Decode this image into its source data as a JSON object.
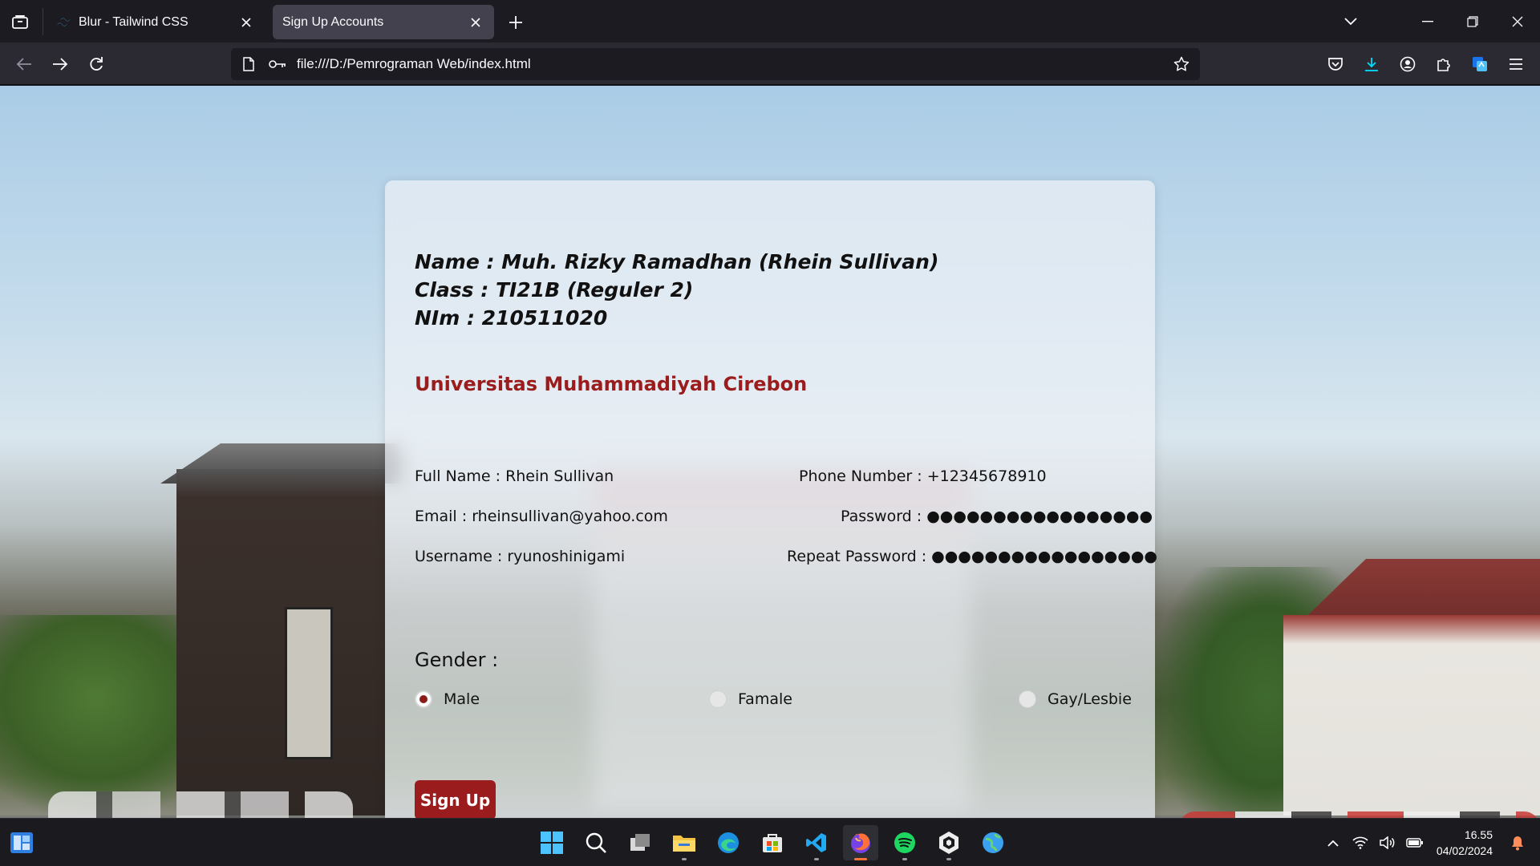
{
  "browser": {
    "tabs": [
      {
        "title": "Blur - Tailwind CSS",
        "active": false
      },
      {
        "title": "Sign Up Accounts",
        "active": true
      }
    ],
    "url": "file:///D:/Pemrograman Web/index.html"
  },
  "card": {
    "name_line": "Name : Muh. Rizky Ramadhan (Rhein Sullivan)",
    "class_line": "Class : TI21B (Reguler 2)",
    "nim_line": "NIm : 210511020",
    "university": "Universitas Muhammadiyah Cirebon",
    "fields": {
      "full_name": "Full Name : Rhein Sullivan",
      "phone": "Phone Number : +12345678910",
      "email": "Email : rheinsullivan@yahoo.com",
      "password": "Password : ●●●●●●●●●●●●●●●●●",
      "username": "Username : ryunoshinigami",
      "repeat_password": "Repeat Password : ●●●●●●●●●●●●●●●●●"
    },
    "gender_label": "Gender :",
    "gender_options": [
      {
        "label": "Male",
        "checked": true
      },
      {
        "label": "Famale",
        "checked": false
      },
      {
        "label": "Gay/Lesbie",
        "checked": false
      }
    ],
    "submit_label": "Sign Up"
  },
  "colors": {
    "accent": "#9b1c1c",
    "university_text": "#9b1c1c"
  },
  "taskbar": {
    "apps": [
      "start-icon",
      "search-icon",
      "task-view-icon",
      "file-explorer-icon",
      "edge-icon",
      "store-icon",
      "vscode-icon",
      "firefox-icon",
      "spotify-icon",
      "app-icon",
      "globe-icon"
    ],
    "active_app": "firefox-icon",
    "time": "16.55",
    "date": "04/02/2024"
  }
}
